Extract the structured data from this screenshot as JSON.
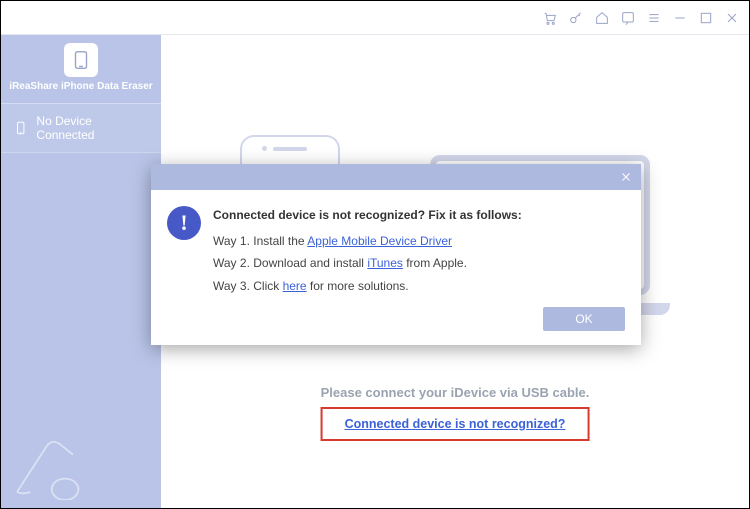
{
  "app": {
    "title": "iReaShare iPhone Data Eraser"
  },
  "sidebar": {
    "device_status": "No Device Connected"
  },
  "main": {
    "caption": "Please connect your iDevice via USB cable.",
    "link_text": "Connected device is not recognized?"
  },
  "dialog": {
    "heading": "Connected device is not recognized? Fix it as follows:",
    "way1_pre": "Way 1. Install the ",
    "way1_link": "Apple Mobile Device Driver",
    "way2_pre": "Way 2. Download and install ",
    "way2_link": "iTunes",
    "way2_post": " from Apple.",
    "way3_pre": "Way 3. Click ",
    "way3_link": "here",
    "way3_post": " for more solutions.",
    "ok": "OK"
  }
}
